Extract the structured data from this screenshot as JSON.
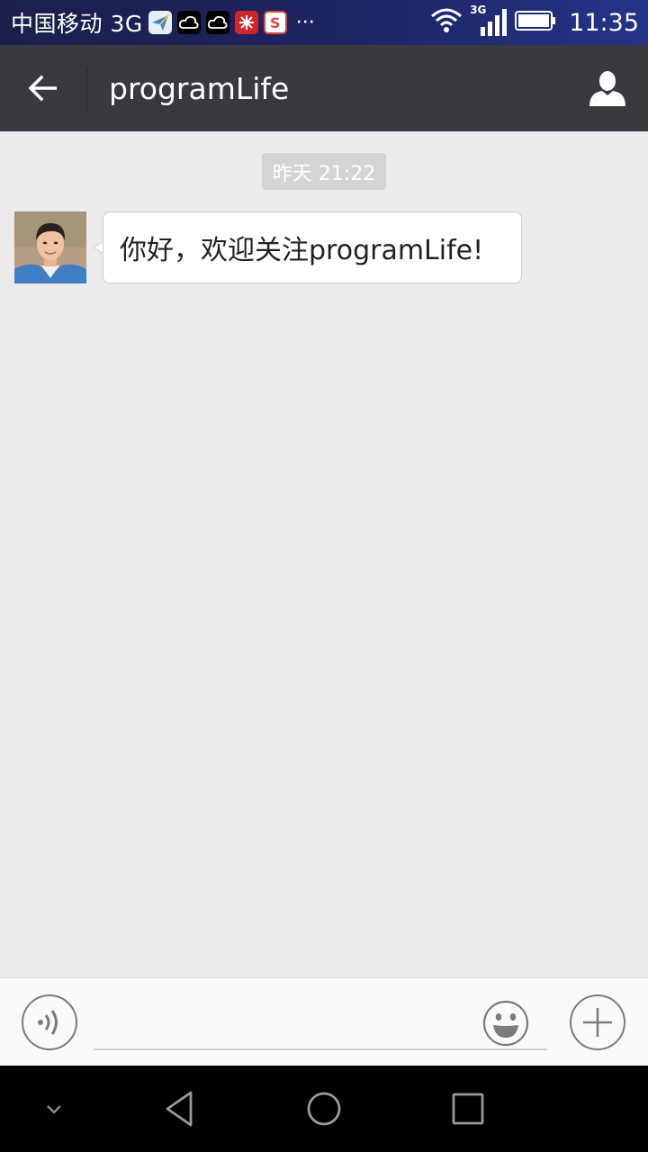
{
  "status_bar": {
    "carrier": "中国移动 3G",
    "overflow": "···",
    "network_label": "3G",
    "time": "11:35",
    "icons": [
      "paper-plane-icon",
      "cloud-icon",
      "cloud-icon",
      "flower-icon",
      "sogou-icon",
      "wifi-icon",
      "signal-icon",
      "battery-icon"
    ]
  },
  "header": {
    "title": "programLife",
    "back_icon": "arrow-left-icon",
    "profile_icon": "person-icon"
  },
  "chat": {
    "timestamp": "昨天 21:22",
    "messages": [
      {
        "sender": "programLife",
        "text": "你好，欢迎关注programLife!"
      }
    ]
  },
  "input_bar": {
    "placeholder": "",
    "voice_icon": "voice-icon",
    "emoji_icon": "smiley-icon",
    "plus_icon": "plus-icon"
  },
  "nav_bar": {
    "icons": [
      "chevron-down-icon",
      "back-triangle-icon",
      "home-circle-icon",
      "recents-square-icon"
    ]
  },
  "colors": {
    "title_bar": "#393a3f",
    "chat_bg": "#ebebeb",
    "status_bar": "#1d2563"
  }
}
